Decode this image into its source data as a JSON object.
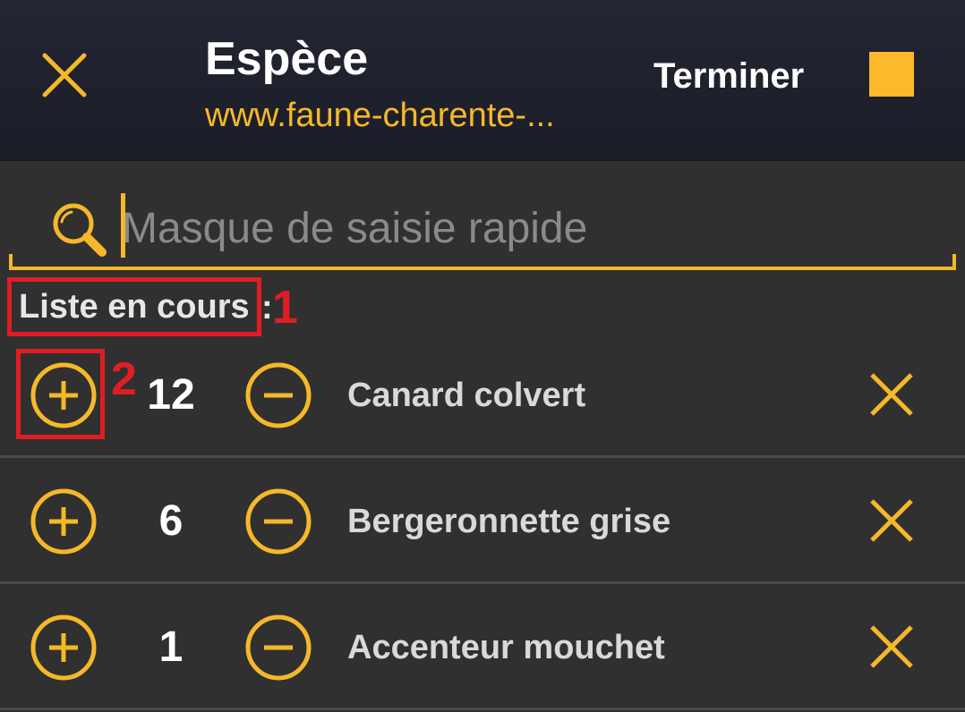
{
  "header": {
    "title": "Espèce",
    "subtitle": "www.faune-charente-...",
    "finish_label": "Terminer",
    "close_icon": "close-icon",
    "accent_color": "#f5b82a",
    "background_color": "#1e2029"
  },
  "search": {
    "placeholder": "Masque de saisie rapide",
    "value": "",
    "icon": "search-icon"
  },
  "list": {
    "label": "Liste en cours",
    "separator": ":",
    "items": [
      {
        "count": "12",
        "species": "Canard colvert"
      },
      {
        "count": "6",
        "species": "Bergeronnette grise"
      },
      {
        "count": "1",
        "species": "Accenteur mouchet"
      }
    ]
  },
  "annotations": {
    "marker_1": "1",
    "marker_2": "2",
    "color": "#e11d24"
  }
}
